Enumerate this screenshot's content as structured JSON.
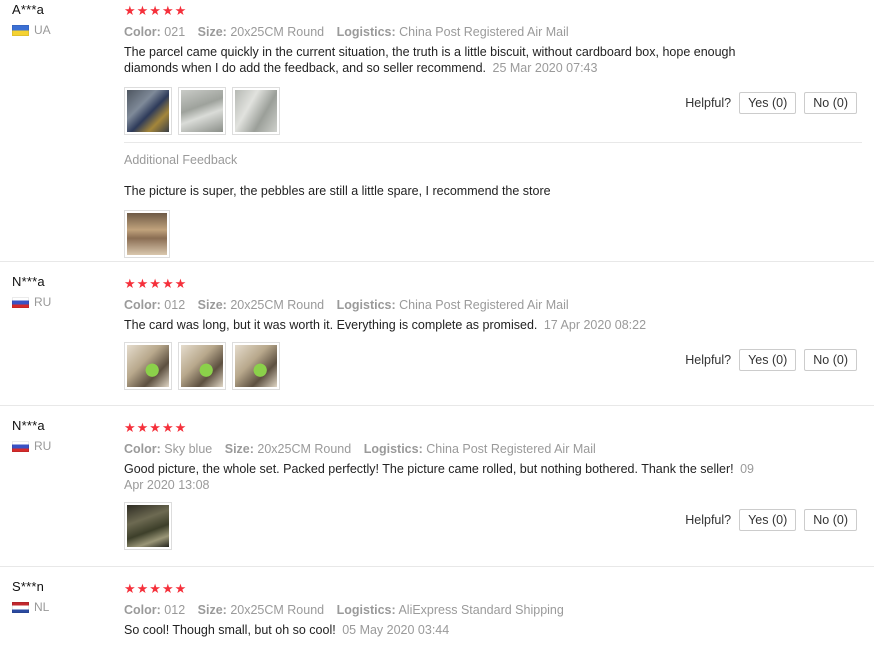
{
  "reviews": [
    {
      "user": "A***a",
      "country": "UA",
      "flag": "ukraine-flag",
      "stars": "★★★★★",
      "color_label": "Color:",
      "color": "021",
      "size_label": "Size:",
      "size": "20x25CM Round",
      "logistics_label": "Logistics:",
      "logistics": "China Post Registered Air Mail",
      "text": "The parcel came quickly in the current situation, the truth is a little biscuit, without cardboard box, hope enough diamonds when I do add the feedback, and so seller recommend.",
      "date": "25 Mar 2020 07:43",
      "helpful_label": "Helpful?",
      "yes": "Yes (0)",
      "no": "No (0)",
      "additional_title": "Additional Feedback",
      "additional_text": "The picture is super, the pebbles are still a little spare, I recommend the store"
    },
    {
      "user": "N***a",
      "country": "RU",
      "flag": "russia-flag",
      "stars": "★★★★★",
      "color_label": "Color:",
      "color": "012",
      "size_label": "Size:",
      "size": "20x25CM Round",
      "logistics_label": "Logistics:",
      "logistics": "China Post Registered Air Mail",
      "text": "The card was long, but it was worth it. Everything is complete as promised.",
      "date": "17 Apr 2020 08:22",
      "helpful_label": "Helpful?",
      "yes": "Yes (0)",
      "no": "No (0)"
    },
    {
      "user": "N***a",
      "country": "RU",
      "flag": "russia-flag",
      "stars": "★★★★★",
      "color_label": "Color:",
      "color": "Sky blue",
      "size_label": "Size:",
      "size": "20x25CM Round",
      "logistics_label": "Logistics:",
      "logistics": "China Post Registered Air Mail",
      "text": "Good picture, the whole set. Packed perfectly! The picture came rolled, but nothing bothered. Thank the seller!",
      "date": "09 Apr 2020 13:08",
      "helpful_label": "Helpful?",
      "yes": "Yes (0)",
      "no": "No (0)"
    },
    {
      "user": "S***n",
      "country": "NL",
      "flag": "netherlands-flag",
      "stars": "★★★★★",
      "color_label": "Color:",
      "color": "012",
      "size_label": "Size:",
      "size": "20x25CM Round",
      "logistics_label": "Logistics:",
      "logistics": "AliExpress Standard Shipping",
      "text": "So cool! Though small, but oh so cool!",
      "date": "05 May 2020 03:44"
    }
  ],
  "colors": {
    "star": "#f5303b",
    "muted_text": "#9a9a9a",
    "divider": "#e8e8e8",
    "button_border": "#cccccc"
  }
}
